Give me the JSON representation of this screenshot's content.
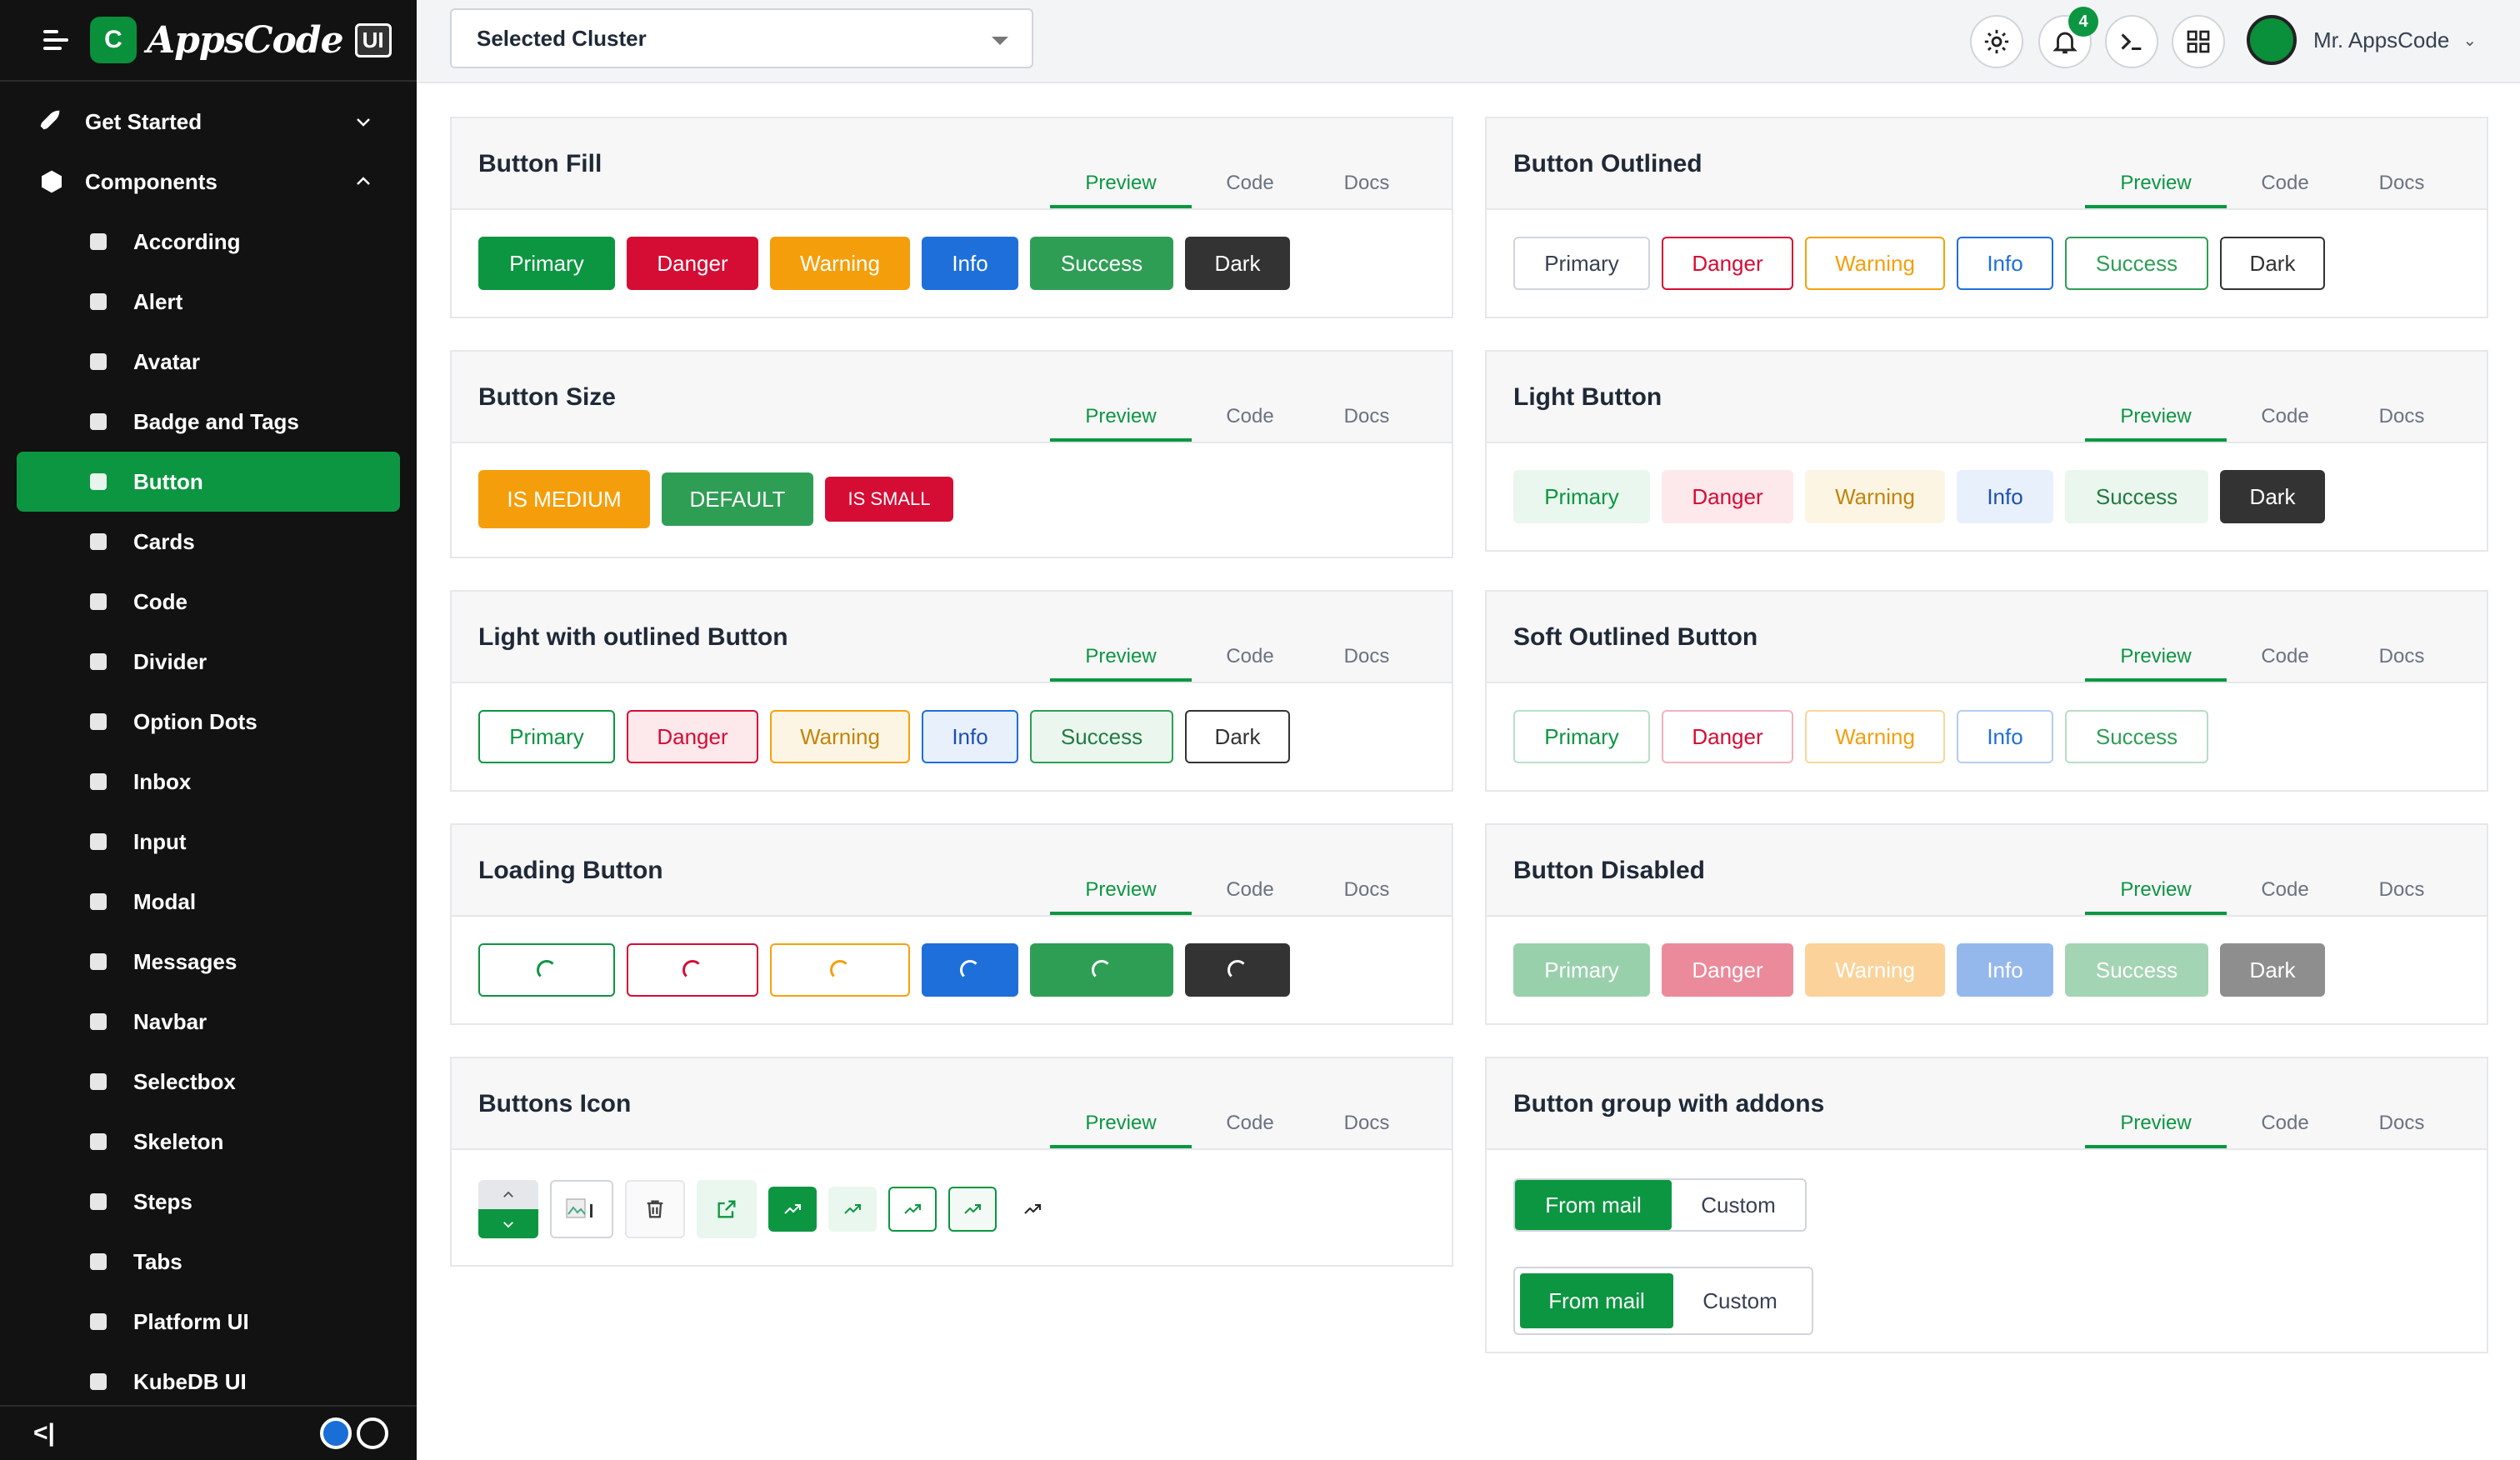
{
  "app": {
    "brand": "AppsCode",
    "brand_badge": "UI"
  },
  "sidebar": {
    "groups": [
      {
        "label": "Get Started",
        "icon": "rocket-icon"
      },
      {
        "label": "Components",
        "icon": "cube-icon"
      }
    ],
    "items": [
      {
        "label": "According",
        "icon": "accordion-icon"
      },
      {
        "label": "Alert",
        "icon": "alert-bell-icon"
      },
      {
        "label": "Avatar",
        "icon": "user-circle-icon"
      },
      {
        "label": "Badge and Tags",
        "icon": "tag-icon"
      },
      {
        "label": "Button",
        "icon": "pointer-icon",
        "active": true
      },
      {
        "label": "Cards",
        "icon": "card-icon"
      },
      {
        "label": "Code",
        "icon": "code-icon"
      },
      {
        "label": "Divider",
        "icon": "divider-icon"
      },
      {
        "label": "Option Dots",
        "icon": "dots-icon"
      },
      {
        "label": "Inbox",
        "icon": "inbox-icon"
      },
      {
        "label": "Input",
        "icon": "input-icon"
      },
      {
        "label": "Modal",
        "icon": "modal-icon"
      },
      {
        "label": "Messages",
        "icon": "chat-icon"
      },
      {
        "label": "Navbar",
        "icon": "menu-icon"
      },
      {
        "label": "Selectbox",
        "icon": "pointer-icon"
      },
      {
        "label": "Skeleton",
        "icon": "spinner-icon"
      },
      {
        "label": "Steps",
        "icon": "steps-icon"
      },
      {
        "label": "Tabs",
        "icon": "folder-icon"
      },
      {
        "label": "Platform UI",
        "icon": "user-gear-icon"
      },
      {
        "label": "KubeDB UI",
        "icon": "cube-icon"
      }
    ]
  },
  "header": {
    "cluster_label": "Selected Cluster",
    "notifications": "4",
    "user": "Mr. AppsCode"
  },
  "tabs": [
    "Preview",
    "Code",
    "Docs"
  ],
  "labels": [
    "Primary",
    "Danger",
    "Warning",
    "Info",
    "Success",
    "Dark"
  ],
  "cards": {
    "fill": "Button Fill",
    "outlined": "Button Outlined",
    "size": "Button Size",
    "light": "Light Button",
    "light_outlined": "Light with outlined Button",
    "soft": "Soft Outlined Button",
    "loading": "Loading Button",
    "disabled": "Button Disabled",
    "icon": "Buttons Icon",
    "group": "Button group with addons"
  },
  "size_buttons": [
    "IS MEDIUM",
    "DEFAULT",
    "IS SMALL"
  ],
  "group_buttons": {
    "a": "From mail",
    "b": "Custom"
  },
  "colors": {
    "accent": "#0c9641",
    "danger": "#d50c34",
    "warning": "#f59e0b",
    "info": "#1e6fd9",
    "success": "#2e9e55",
    "dark": "#333333"
  }
}
